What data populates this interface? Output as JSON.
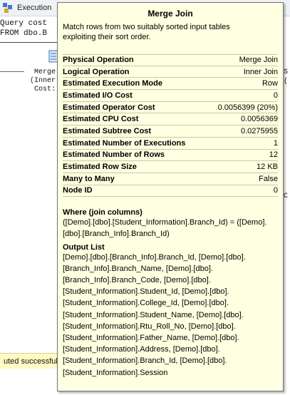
{
  "window": {
    "tab_label": "Execution",
    "query_lines": [
      "Query cost",
      "FROM dbo.B"
    ],
    "plan_node_lines": [
      "Merge",
      "(Inner",
      "Cost:"
    ],
    "right_fragments": [
      "S",
      "(",
      "C"
    ],
    "status_text": "uted successful"
  },
  "tooltip": {
    "title": "Merge Join",
    "description": "Match rows from two suitably sorted input tables exploiting their sort order.",
    "properties": [
      {
        "label": "Physical Operation",
        "value": "Merge Join"
      },
      {
        "label": "Logical Operation",
        "value": "Inner Join"
      },
      {
        "label": "Estimated Execution Mode",
        "value": "Row"
      },
      {
        "label": "Estimated I/O Cost",
        "value": "0"
      },
      {
        "label": "Estimated Operator Cost",
        "value": "0.0056399 (20%)"
      },
      {
        "label": "Estimated CPU Cost",
        "value": "0.0056369"
      },
      {
        "label": "Estimated Subtree Cost",
        "value": "0.0275955"
      },
      {
        "label": "Estimated Number of Executions",
        "value": "1"
      },
      {
        "label": "Estimated Number of Rows",
        "value": "12"
      },
      {
        "label": "Estimated Row Size",
        "value": "12 KB"
      },
      {
        "label": "Many to Many",
        "value": "False"
      },
      {
        "label": "Node ID",
        "value": "0"
      }
    ],
    "where_heading": "Where (join columns)",
    "where_text": "([Demo].[dbo].[Student_Information].Branch_Id) = ([Demo].[dbo].[Branch_Info].Branch_Id)",
    "output_heading": "Output List",
    "output_text": "[Demo].[dbo].[Branch_Info].Branch_Id, [Demo].[dbo].[Branch_Info].Branch_Name, [Demo].[dbo].[Branch_Info].Branch_Code, [Demo].[dbo].[Student_Information].Student_Id, [Demo].[dbo].[Student_Information].College_Id, [Demo].[dbo].[Student_Information].Student_Name, [Demo].[dbo].[Student_Information].Rtu_Roll_No, [Demo].[dbo].[Student_Information].Father_Name, [Demo].[dbo].[Student_Information].Address, [Demo].[dbo].[Student_Information].Branch_Id, [Demo].[dbo].[Student_Information].Session"
  }
}
